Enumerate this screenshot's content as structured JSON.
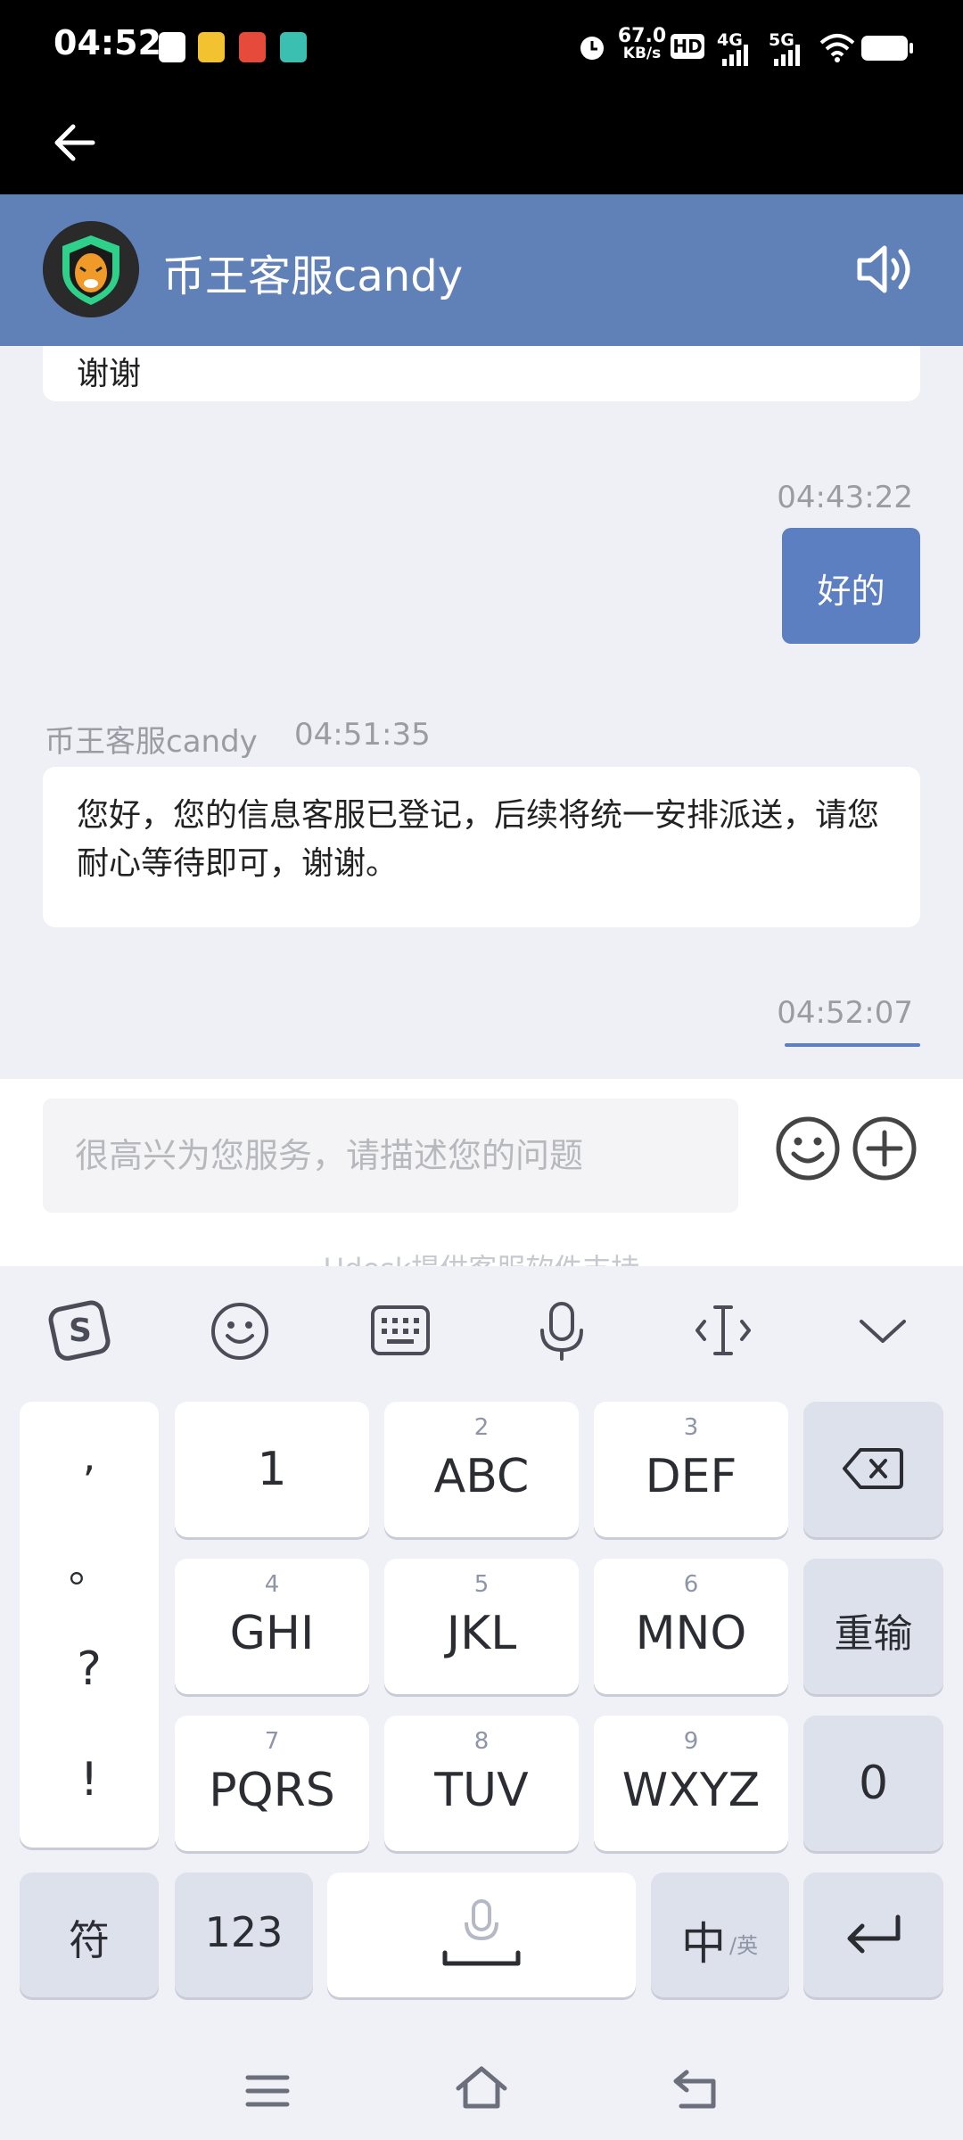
{
  "status_bar": {
    "time": "04:52",
    "net_speed_value": "67.0",
    "net_speed_unit": "KB/s",
    "hd_label": "HD",
    "signal_1": "4G",
    "signal_2": "5G"
  },
  "header": {
    "agent_name": "币王客服candy"
  },
  "chat": {
    "partial_message_text": "谢谢",
    "sent_time_1": "04:43:22",
    "sent_message_1": "好的",
    "agent_meta_name": "币王客服candy",
    "agent_meta_time": "04:51:35",
    "agent_message": "您好，您的信息客服已登记，后续将统一安排派送，请您耐心等待即可，谢谢。",
    "sent_time_2": "04:52:07"
  },
  "input": {
    "placeholder": "很高兴为您服务，请描述您的问题",
    "footer_text": "Udesk提供客服软件支持"
  },
  "keyboard": {
    "punct": [
      ",",
      "。",
      "?",
      "!"
    ],
    "k1": "1",
    "k2_sub": "2",
    "k2": "ABC",
    "k3_sub": "3",
    "k3": "DEF",
    "k4_sub": "4",
    "k4": "GHI",
    "k5_sub": "5",
    "k5": "JKL",
    "k6_sub": "6",
    "k6": "MNO",
    "k7_sub": "7",
    "k7": "PQRS",
    "k8_sub": "8",
    "k8": "TUV",
    "k9_sub": "9",
    "k9": "WXYZ",
    "reenter": "重输",
    "zero": "0",
    "symbols": "符",
    "num123": "123",
    "lang_main": "中",
    "lang_alt": "/英"
  },
  "colors": {
    "header_bg": "#6080b8",
    "sent_bubble": "#5b7fc0",
    "chat_bg": "#eef0f5"
  }
}
